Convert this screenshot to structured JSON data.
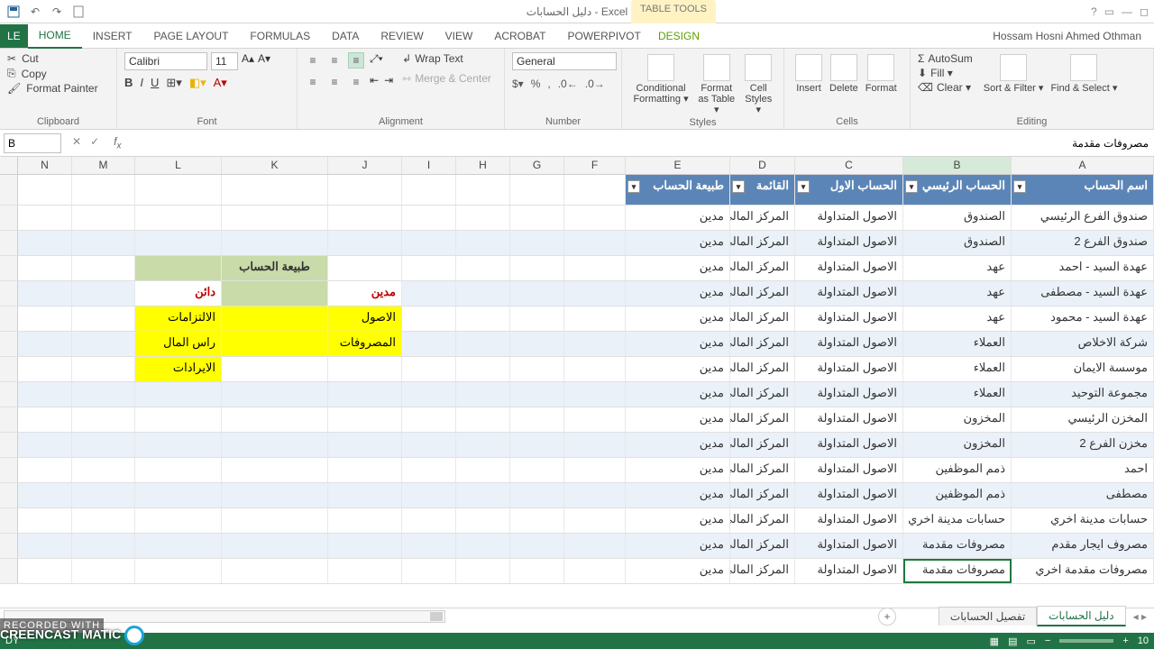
{
  "window": {
    "title": "دليل الحسابات - Excel",
    "table_tools": "TABLE TOOLS",
    "user": "Hossam Hosni Ahmed Othman"
  },
  "tabs": {
    "file": "LE",
    "home": "HOME",
    "insert": "INSERT",
    "page": "PAGE LAYOUT",
    "formulas": "FORMULAS",
    "data": "DATA",
    "review": "REVIEW",
    "view": "VIEW",
    "acrobat": "ACROBAT",
    "powerpivot": "POWERPIVOT",
    "design": "DESIGN"
  },
  "ribbon": {
    "clipboard": {
      "cut": "Cut",
      "copy": "Copy",
      "painter": "Format Painter",
      "label": "Clipboard"
    },
    "font": {
      "name": "Calibri",
      "size": "11",
      "label": "Font"
    },
    "alignment": {
      "wrap": "Wrap Text",
      "merge": "Merge & Center",
      "label": "Alignment"
    },
    "number": {
      "format": "General",
      "label": "Number"
    },
    "styles": {
      "cond": "Conditional Formatting ▾",
      "fat": "Format as Table ▾",
      "cell": "Cell Styles ▾",
      "label": "Styles"
    },
    "cells": {
      "insert": "Insert",
      "delete": "Delete",
      "format": "Format",
      "label": "Cells"
    },
    "editing": {
      "autosum": "AutoSum",
      "fill": "Fill ▾",
      "clear": "Clear ▾",
      "sort": "Sort & Filter ▾",
      "find": "Find & Select ▾",
      "label": "Editing"
    }
  },
  "namebox": "B",
  "formula": "مصروفات مقدمة",
  "columns": [
    "N",
    "M",
    "L",
    "K",
    "J",
    "I",
    "H",
    "G",
    "F",
    "E",
    "D",
    "C",
    "B",
    "A"
  ],
  "table": {
    "headers": {
      "E": "طبيعة الحساب",
      "D": "القائمة",
      "C": "الحساب الاول",
      "B": "الحساب الرئيسي",
      "A": "اسم الحساب"
    },
    "rows": [
      {
        "A": "صندوق الفرع الرئيسي",
        "B": "الصندوق",
        "C": "الاصول المتداولة",
        "D": "المركز المالي",
        "E": "مدين"
      },
      {
        "A": "صندوق الفرع 2",
        "B": "الصندوق",
        "C": "الاصول المتداولة",
        "D": "المركز المالي",
        "E": "مدين"
      },
      {
        "A": "عهدة السيد - احمد",
        "B": "عهد",
        "C": "الاصول المتداولة",
        "D": "المركز المالي",
        "E": "مدين"
      },
      {
        "A": "عهدة  السيد - مصطفى",
        "B": "عهد",
        "C": "الاصول المتداولة",
        "D": "المركز المالي",
        "E": "مدين"
      },
      {
        "A": "عهدة السيد - محمود",
        "B": "عهد",
        "C": "الاصول المتداولة",
        "D": "المركز المالي",
        "E": "مدين"
      },
      {
        "A": "شركة الاخلاص",
        "B": "العملاء",
        "C": "الاصول المتداولة",
        "D": "المركز المالي",
        "E": "مدين"
      },
      {
        "A": "موسسة الايمان",
        "B": "العملاء",
        "C": "الاصول المتداولة",
        "D": "المركز المالي",
        "E": "مدين"
      },
      {
        "A": "مجموعة التوحيد",
        "B": "العملاء",
        "C": "الاصول المتداولة",
        "D": "المركز المالي",
        "E": "مدين"
      },
      {
        "A": "المخزن الرئيسي",
        "B": "المخزون",
        "C": "الاصول المتداولة",
        "D": "المركز المالي",
        "E": "مدين"
      },
      {
        "A": "مخزن الفرع 2",
        "B": "المخزون",
        "C": "الاصول المتداولة",
        "D": "المركز المالي",
        "E": "مدين"
      },
      {
        "A": "احمد",
        "B": "ذمم الموظفين",
        "C": "الاصول المتداولة",
        "D": "المركز المالي",
        "E": "مدين"
      },
      {
        "A": "مصطفى",
        "B": "ذمم الموظفين",
        "C": "الاصول المتداولة",
        "D": "المركز المالي",
        "E": "مدين"
      },
      {
        "A": "حسابات مدينة اخري",
        "B": "حسابات مدينة اخري",
        "C": "الاصول المتداولة",
        "D": "المركز المالي",
        "E": "مدين"
      },
      {
        "A": "مصروف ايجار مقدم",
        "B": "مصروفات مقدمة",
        "C": "الاصول المتداولة",
        "D": "المركز المالي",
        "E": "مدين"
      },
      {
        "A": "مصروفات مقدمة اخري",
        "B": "مصروفات مقدمة",
        "C": "الاصول المتداولة",
        "D": "المركز المالي",
        "E": "مدين"
      }
    ]
  },
  "mini": {
    "header": "طبيعة الحساب",
    "left_head": "دائن",
    "right_head": "مدين",
    "left": [
      "الالتزامات",
      "راس المال",
      "الايرادات"
    ],
    "right": [
      "الاصول",
      "المصروفات"
    ]
  },
  "sheets": {
    "active": "دليل الحسابات",
    "other": "تفصيل الحسابات"
  },
  "status": {
    "ready": "DY",
    "zoom": "10"
  },
  "watermark": {
    "l1": "RECORDED WITH",
    "l2": "CREENCAST    MATIC"
  }
}
